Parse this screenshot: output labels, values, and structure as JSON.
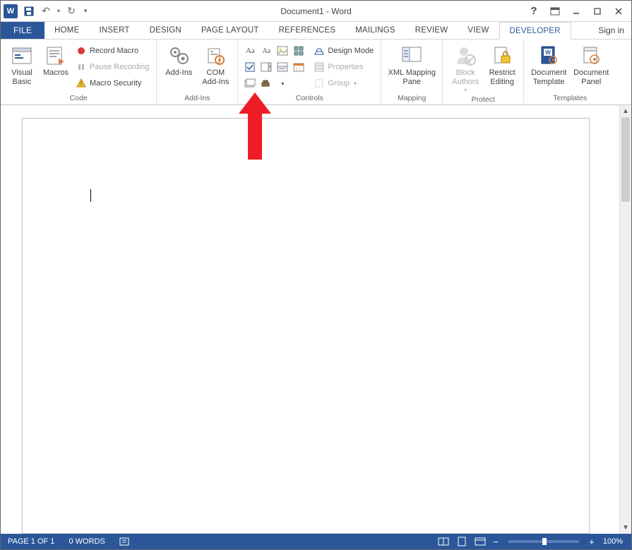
{
  "title": "Document1 - Word",
  "signin": "Sign in",
  "tabs": [
    "FILE",
    "HOME",
    "INSERT",
    "DESIGN",
    "PAGE LAYOUT",
    "REFERENCES",
    "MAILINGS",
    "REVIEW",
    "VIEW",
    "DEVELOPER"
  ],
  "active_tab": "DEVELOPER",
  "ribbon": {
    "code": {
      "label": "Code",
      "visual_basic": "Visual\nBasic",
      "macros": "Macros",
      "record_macro": "Record Macro",
      "pause_recording": "Pause Recording",
      "macro_security": "Macro Security"
    },
    "addins": {
      "label": "Add-Ins",
      "addins": "Add-Ins",
      "com_addins": "COM\nAdd-Ins"
    },
    "controls": {
      "label": "Controls",
      "design_mode": "Design Mode",
      "properties": "Properties",
      "group": "Group"
    },
    "mapping": {
      "label": "Mapping",
      "xml_mapping": "XML Mapping\nPane"
    },
    "protect": {
      "label": "Protect",
      "block_authors": "Block\nAuthors",
      "restrict_editing": "Restrict\nEditing"
    },
    "templates": {
      "label": "Templates",
      "doc_template": "Document\nTemplate",
      "doc_panel": "Document\nPanel"
    }
  },
  "status": {
    "page": "PAGE 1 OF 1",
    "words": "0 WORDS",
    "zoom": "100%"
  }
}
